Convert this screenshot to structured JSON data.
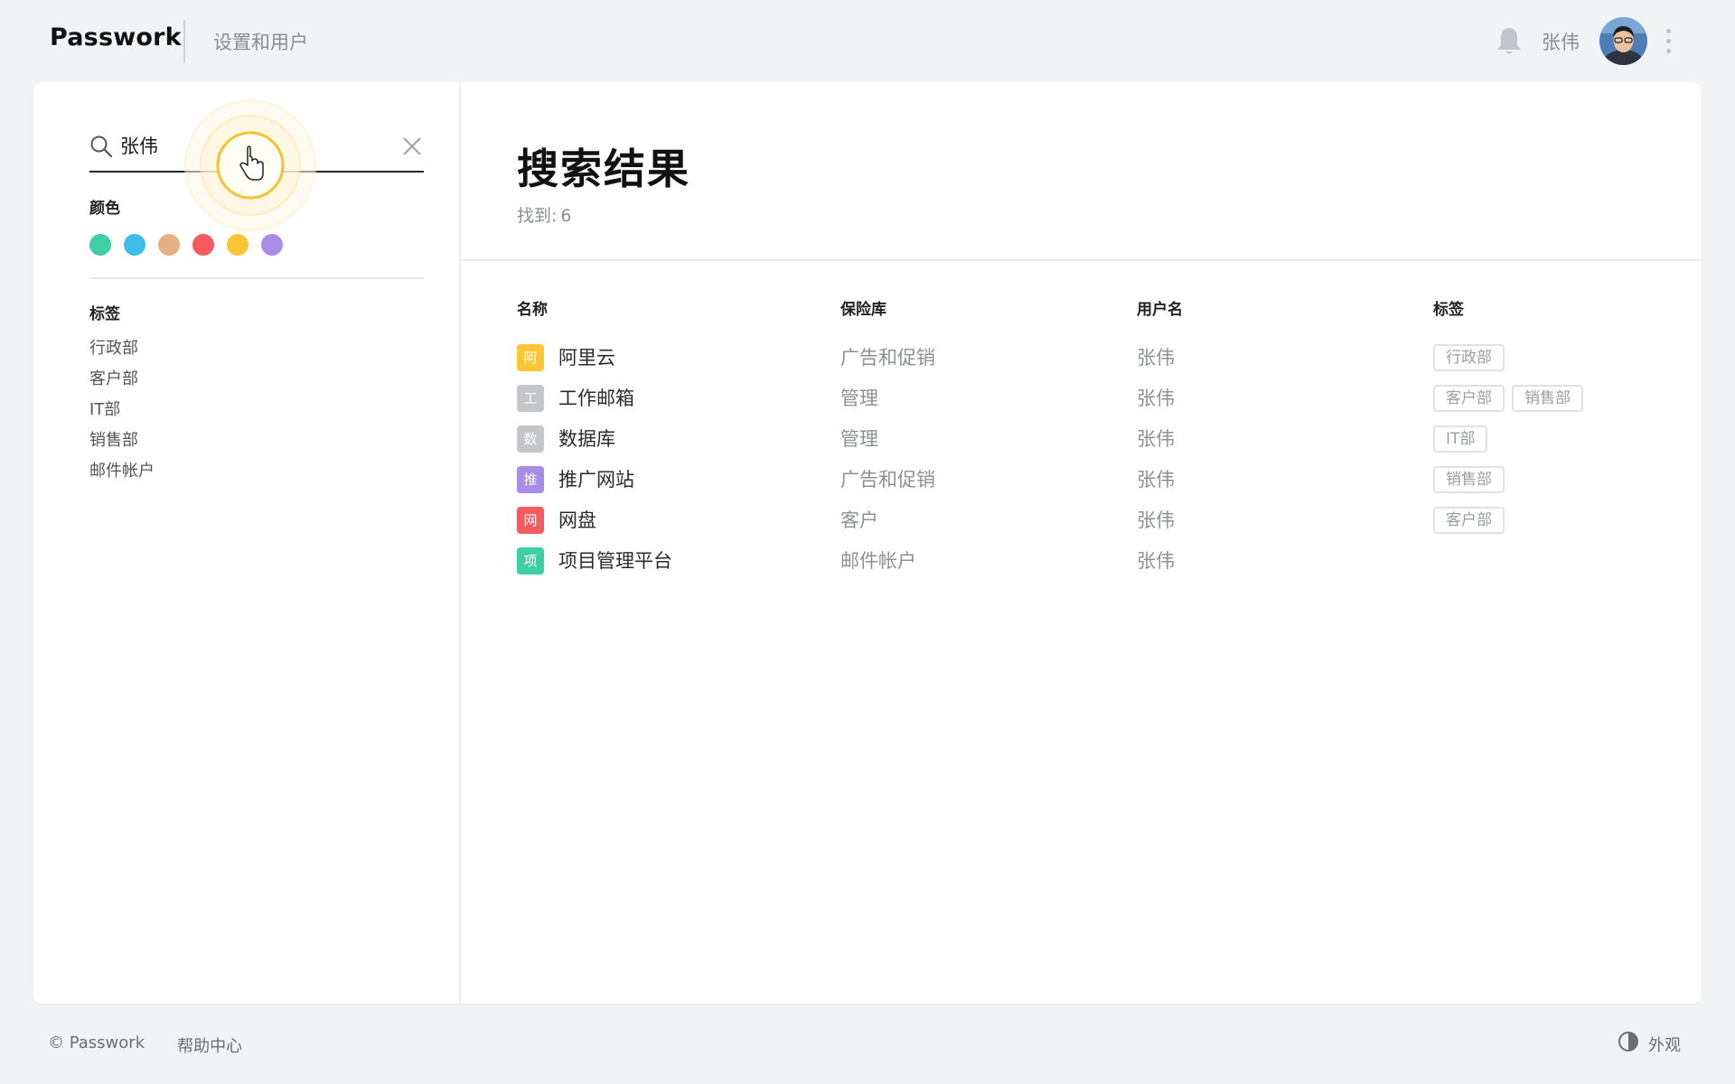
{
  "header": {
    "brand": "Passwork",
    "nav_link": "设置和用户",
    "user_name": "张伟"
  },
  "sidebar": {
    "search": {
      "value": "张伟",
      "placeholder": ""
    },
    "colors_title": "颜色",
    "colors": [
      "#3ecfa5",
      "#3dbde9",
      "#e4b184",
      "#f45b5f",
      "#fcc536",
      "#a98be8"
    ],
    "tags_title": "标签",
    "tags": [
      "行政部",
      "客户部",
      "IT部",
      "销售部",
      "邮件帐户"
    ]
  },
  "main": {
    "title": "搜索结果",
    "found_label": "找到:",
    "found_count": "6",
    "columns": {
      "name": "名称",
      "vault": "保险库",
      "username": "用户名",
      "tags": "标签"
    },
    "rows": [
      {
        "icon": "阿",
        "icon_color": "#fcc536",
        "name": "阿里云",
        "vault": "广告和促销",
        "username": "张伟",
        "tags": [
          "行政部"
        ]
      },
      {
        "icon": "工",
        "icon_color": "#c4c6c9",
        "name": "工作邮箱",
        "vault": "管理",
        "username": "张伟",
        "tags": [
          "客户部",
          "销售部"
        ]
      },
      {
        "icon": "数",
        "icon_color": "#c4c6c9",
        "name": "数据库",
        "vault": "管理",
        "username": "张伟",
        "tags": [
          "IT部"
        ]
      },
      {
        "icon": "推",
        "icon_color": "#a98be8",
        "name": "推广网站",
        "vault": "广告和促销",
        "username": "张伟",
        "tags": [
          "销售部"
        ]
      },
      {
        "icon": "网",
        "icon_color": "#f45b5f",
        "name": "网盘",
        "vault": "客户",
        "username": "张伟",
        "tags": [
          "客户部"
        ]
      },
      {
        "icon": "项",
        "icon_color": "#3ecfa5",
        "name": "项目管理平台",
        "vault": "邮件帐户",
        "username": "张伟",
        "tags": []
      }
    ]
  },
  "footer": {
    "copyright": "© Passwork",
    "help": "帮助中心",
    "appearance": "外观"
  }
}
